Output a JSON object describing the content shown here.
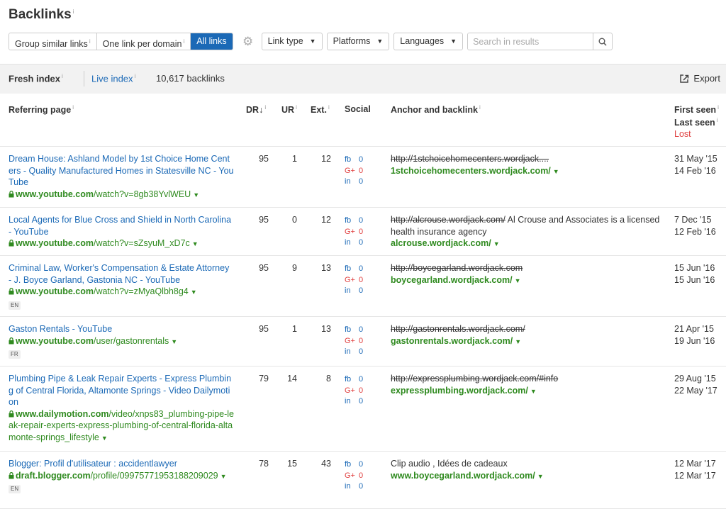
{
  "header": {
    "title": "Backlinks",
    "info": "i"
  },
  "toolbar": {
    "segments": [
      "Group similar links",
      "One link per domain",
      "All links"
    ],
    "info": "i",
    "dropdowns": [
      "Link type",
      "Platforms",
      "Languages"
    ],
    "search_placeholder": "Search in results"
  },
  "index_bar": {
    "fresh": "Fresh index",
    "live": "Live index",
    "count": "10,617 backlinks",
    "export": "Export"
  },
  "columns": {
    "referring_page": "Referring page",
    "dr": "DR",
    "ur": "UR",
    "ext": "Ext.",
    "social": "Social",
    "anchor": "Anchor and backlink",
    "first_seen": "First seen",
    "last_seen": "Last seen",
    "lost": "Lost"
  },
  "social_labels": {
    "fb": "fb",
    "gp": "G+",
    "in": "in"
  },
  "rows": [
    {
      "title": "Dream House: Ashland Model by 1st Choice Home Centers - Quality Manufactured Homes in Statesville NC - YouTube",
      "url_domain": "www.youtube.com",
      "url_path": "/watch?v=8gb38YvlWEU",
      "lang": "",
      "dr": "95",
      "ur": "1",
      "ext": "12",
      "fb": "0",
      "gp": "0",
      "in": "0",
      "anchor_strike": "http://1stchoicehomecenters.wordjack....",
      "anchor_text": "",
      "backlink": "1stchoicehomecenters.wordjack.com/",
      "first_seen": "31 May '15",
      "last_seen": "14 Feb '16"
    },
    {
      "title": "Local Agents for Blue Cross and Shield in North Carolina - YouTube",
      "url_domain": "www.youtube.com",
      "url_path": "/watch?v=sZsyuM_xD7c",
      "lang": "",
      "dr": "95",
      "ur": "0",
      "ext": "12",
      "fb": "0",
      "gp": "0",
      "in": "0",
      "anchor_strike": "http://alcrouse.wordjack.com/",
      "anchor_text": "Al Crouse and Associates is a licensed health insurance agency",
      "backlink": "alcrouse.wordjack.com/",
      "first_seen": "7 Dec '15",
      "last_seen": "12 Feb '16"
    },
    {
      "title": "Criminal Law, Worker's Compensation & Estate Attorney - J. Boyce Garland, Gastonia NC - YouTube",
      "url_domain": "www.youtube.com",
      "url_path": "/watch?v=zMyaQlbh8g4",
      "lang": "EN",
      "dr": "95",
      "ur": "9",
      "ext": "13",
      "fb": "0",
      "gp": "0",
      "in": "0",
      "anchor_strike": "http://boycegarland.wordjack.com",
      "anchor_text": "",
      "backlink": "boycegarland.wordjack.com/",
      "first_seen": "15 Jun '16",
      "last_seen": "15 Jun '16"
    },
    {
      "title": "Gaston Rentals - YouTube",
      "url_domain": "www.youtube.com",
      "url_path": "/user/gastonrentals",
      "lang": "FR",
      "dr": "95",
      "ur": "1",
      "ext": "13",
      "fb": "0",
      "gp": "0",
      "in": "0",
      "anchor_strike": "http://gastonrentals.wordjack.com/",
      "anchor_text": "",
      "backlink": "gastonrentals.wordjack.com/",
      "first_seen": "21 Apr '15",
      "last_seen": "19 Jun '16"
    },
    {
      "title": "Plumbing Pipe & Leak Repair Experts - Express Plumbing of Central Florida, Altamonte Springs - Video Dailymotion",
      "url_domain": "www.dailymotion.com",
      "url_path": "/video/xnps83_plumbing-pipe-leak-repair-experts-express-plumbing-of-central-florida-altamonte-springs_lifestyle",
      "lang": "",
      "dr": "79",
      "ur": "14",
      "ext": "8",
      "fb": "0",
      "gp": "0",
      "in": "0",
      "anchor_strike": "http://expressplumbing.wordjack.com/#info",
      "anchor_text": "",
      "backlink": "expressplumbing.wordjack.com/",
      "first_seen": "29 Aug '15",
      "last_seen": "22 May '17"
    },
    {
      "title": "Blogger: Profil d'utilisateur : accidentlawyer",
      "url_domain": "draft.blogger.com",
      "url_path": "/profile/09975771953188209029",
      "lang": "EN",
      "dr": "78",
      "ur": "15",
      "ext": "43",
      "fb": "0",
      "gp": "0",
      "in": "0",
      "anchor_strike": "",
      "anchor_text": "Clip audio , Idées de cadeaux",
      "backlink": "www.boycegarland.wordjack.com/",
      "first_seen": "12 Mar '17",
      "last_seen": "12 Mar '17"
    }
  ]
}
